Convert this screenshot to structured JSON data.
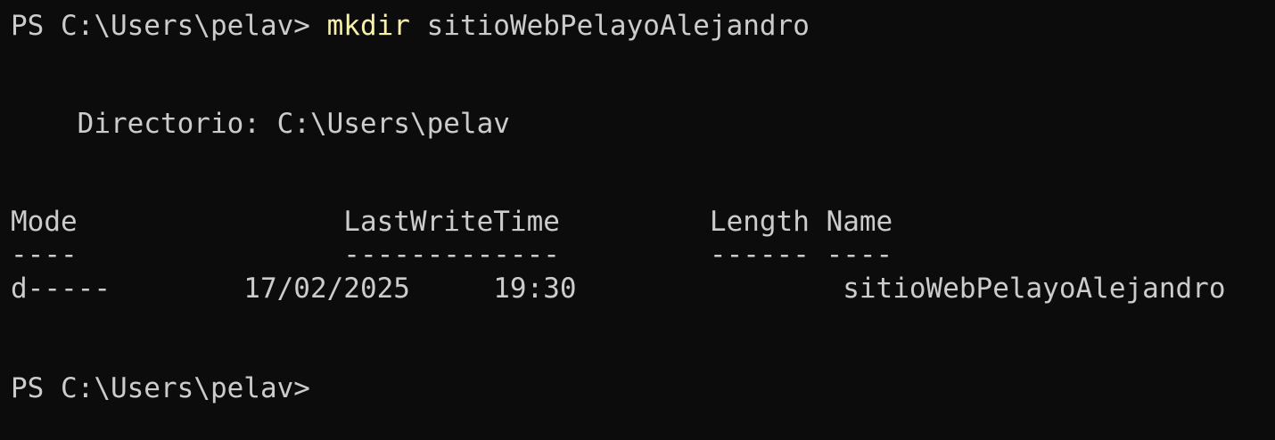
{
  "terminal": {
    "prompt": "PS C:\\Users\\pelav>",
    "command_name": "mkdir",
    "command_arg": "sitioWebPelayoAlejandro",
    "directory_label": "Directorio: C:\\Users\\pelav",
    "table": {
      "columns": [
        "Mode",
        "LastWriteTime",
        "Length",
        "Name"
      ],
      "separators": [
        "----",
        "-------------",
        "------",
        "----"
      ],
      "rows": [
        {
          "mode": "d-----",
          "date": "17/02/2025",
          "time": "19:30",
          "length": "",
          "name": "sitioWebPelayoAlejandro"
        }
      ]
    },
    "final_prompt": "PS C:\\Users\\pelav>",
    "colors": {
      "background": "#0c0c0c",
      "text": "#cccccc",
      "command": "#f9f1a5"
    }
  }
}
